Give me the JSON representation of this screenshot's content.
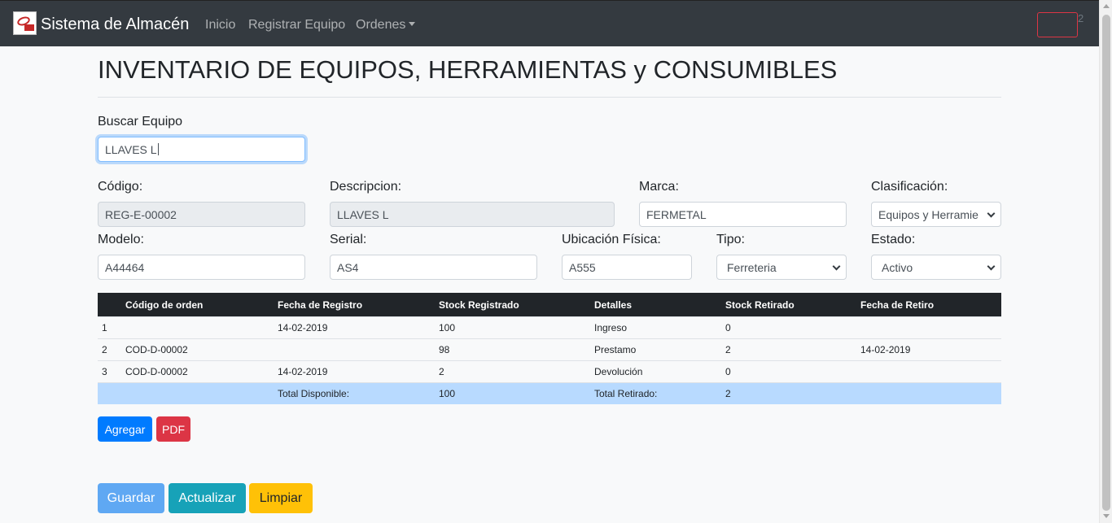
{
  "navbar": {
    "brand": "Sistema de Almacén",
    "links": [
      "Inicio",
      "Registrar Equipo",
      "Ordenes"
    ],
    "badge_count": "2"
  },
  "page": {
    "title": "INVENTARIO DE EQUIPOS, HERRAMIENTAS y CONSUMIBLES"
  },
  "search": {
    "label": "Buscar Equipo",
    "value": "LLAVES L"
  },
  "form": {
    "codigo": {
      "label": "Código:",
      "value": "REG-E-00002"
    },
    "descripcion": {
      "label": "Descripcion:",
      "value": "LLAVES L"
    },
    "marca": {
      "label": "Marca:",
      "value": "FERMETAL"
    },
    "clasificacion": {
      "label": "Clasificación:",
      "value": "Equipos y Herramie"
    },
    "modelo": {
      "label": "Modelo:",
      "value": "A44464"
    },
    "serial": {
      "label": "Serial:",
      "value": "AS4"
    },
    "ubicacion": {
      "label": "Ubicación Física:",
      "value": "A555"
    },
    "tipo": {
      "label": "Tipo:",
      "value": "Ferreteria"
    },
    "estado": {
      "label": "Estado:",
      "value": "Activo"
    }
  },
  "table": {
    "headers": [
      "",
      "Código de orden",
      "Fecha de Registro",
      "Stock Registrado",
      "Detalles",
      "Stock Retirado",
      "Fecha de Retiro"
    ],
    "rows": [
      [
        "1",
        "",
        "14-02-2019",
        "100",
        "Ingreso",
        "0",
        ""
      ],
      [
        "2",
        "COD-D-00002",
        "",
        "98",
        "Prestamo",
        "2",
        "14-02-2019"
      ],
      [
        "3",
        "COD-D-00002",
        "14-02-2019",
        "2",
        "Devolución",
        "0",
        ""
      ]
    ],
    "total": [
      "",
      "",
      "Total Disponible:",
      "100",
      "Total Retirado:",
      "2",
      ""
    ]
  },
  "actions": {
    "agregar": "Agregar",
    "pdf": "PDF",
    "guardar": "Guardar",
    "actualizar": "Actualizar",
    "limpiar": "Limpiar"
  },
  "colors": {
    "navbar": "#343a40",
    "primary": "#007bff",
    "danger": "#dc3545",
    "info": "#17a2b8",
    "warning": "#ffc107",
    "total_row": "#b8daff"
  }
}
